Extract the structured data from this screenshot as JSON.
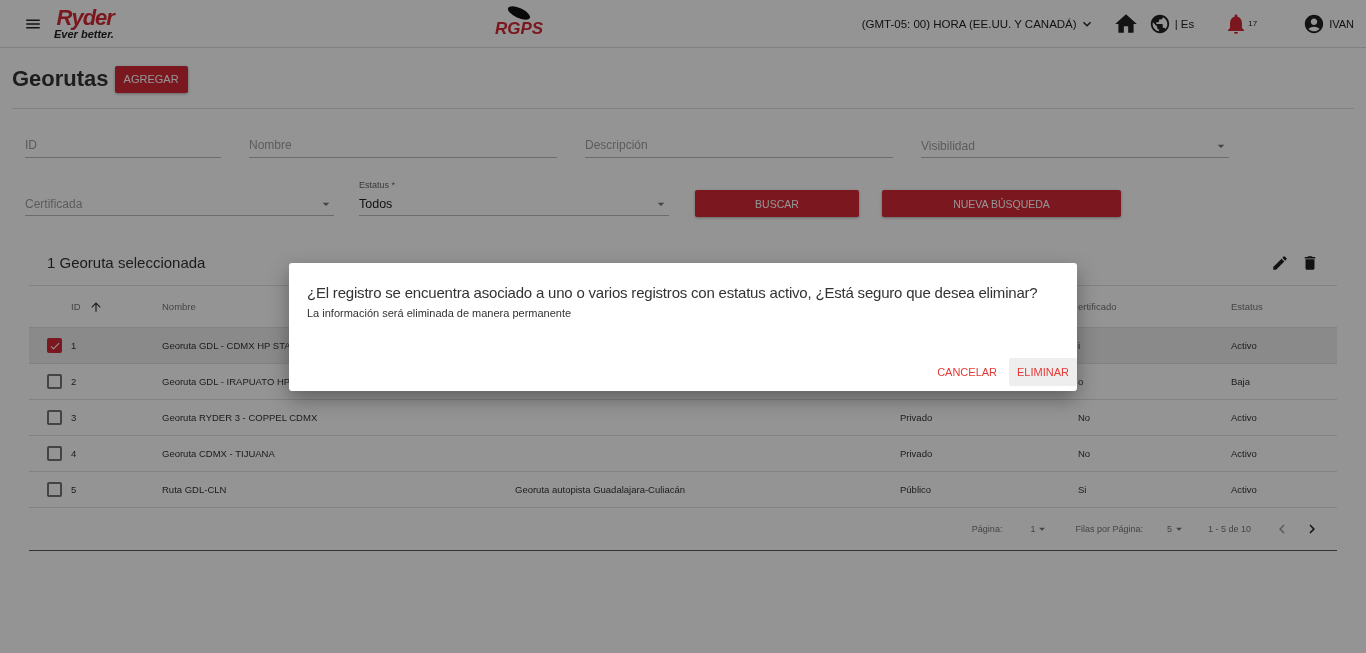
{
  "header": {
    "brand_top": "Ryder",
    "brand_bottom": "Ever better.",
    "app_logo": "RGPS",
    "timezone": "(GMT-05: 00) HORA (EE.UU. Y CANADÁ)",
    "language": "| Es",
    "notifications": "17",
    "user": "IVAN"
  },
  "page": {
    "title": "Georutas",
    "add_button": "AGREGAR"
  },
  "filters": {
    "id": {
      "placeholder": "ID"
    },
    "name": {
      "placeholder": "Nombre"
    },
    "description": {
      "placeholder": "Descripción"
    },
    "visibility": {
      "placeholder": "Visibilidad"
    },
    "certified": {
      "placeholder": "Certificada"
    },
    "status": {
      "label": "Estatus *",
      "value": "Todos"
    },
    "search_button": "BUSCAR",
    "reset_button": "NUEVA BÚSQUEDA"
  },
  "table": {
    "selection_title": "1 Georuta seleccionada",
    "columns": [
      "ID",
      "Nombre",
      "",
      "",
      "ertificado",
      "Estatus"
    ],
    "rows": [
      {
        "selected": true,
        "id": "1",
        "name": "Georuta GDL - CDMX HP STA",
        "description": "",
        "visibility": "",
        "certified": "i",
        "status": "Activo"
      },
      {
        "selected": false,
        "id": "2",
        "name": "Georuta GDL - IRAPUATO HP",
        "description": "",
        "visibility": "",
        "certified": "o",
        "status": "Baja"
      },
      {
        "selected": false,
        "id": "3",
        "name": "Georuta RYDER 3 - COPPEL CDMX",
        "description": "",
        "visibility": "Privado",
        "certified": "No",
        "status": "Activo"
      },
      {
        "selected": false,
        "id": "4",
        "name": "Georuta CDMX - TIJUANA",
        "description": "",
        "visibility": "Privado",
        "certified": "No",
        "status": "Activo"
      },
      {
        "selected": false,
        "id": "5",
        "name": "Ruta GDL-CLN",
        "description": "Georuta autopista Guadalajara-Culiacán",
        "visibility": "Público",
        "certified": "Si",
        "status": "Activo"
      }
    ],
    "pagination": {
      "page_label": "Página:",
      "page": "1",
      "rows_label": "Filas por Página:",
      "rows": "5",
      "range": "1 - 5 de 10"
    }
  },
  "dialog": {
    "title": "¿El registro se encuentra asociado a uno o varios registros con estatus activo, ¿Está seguro que desea eliminar?",
    "message": "La información será eliminada de manera permanente",
    "cancel": "CANCELAR",
    "confirm": "ELIMINAR"
  }
}
